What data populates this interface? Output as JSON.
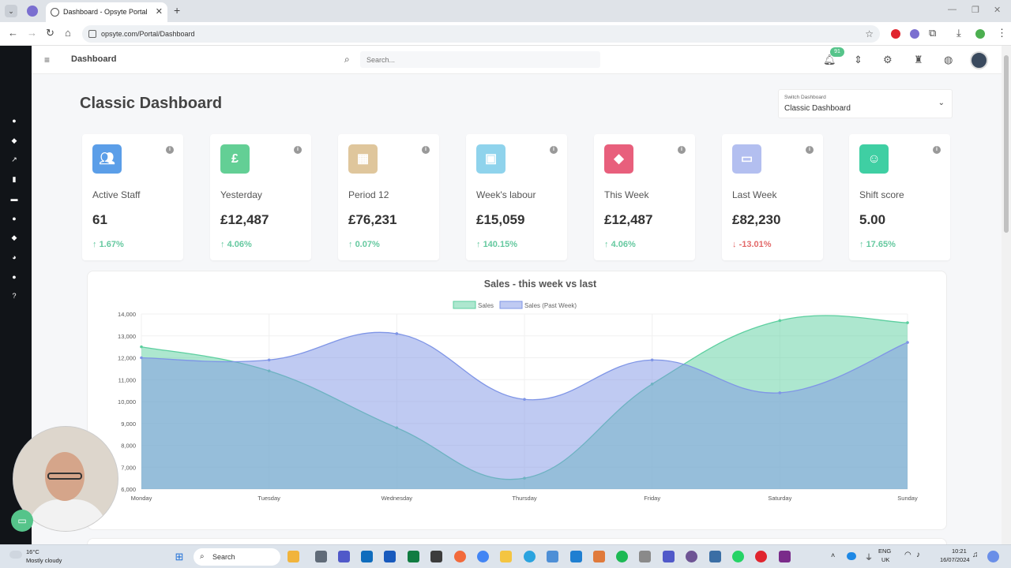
{
  "browser": {
    "tab_title": "Dashboard - Opsyte Portal",
    "url": "opsyte.com/Portal/Dashboard"
  },
  "header": {
    "breadcrumb": "Dashboard",
    "search_placeholder": "Search...",
    "notification_count": "91"
  },
  "page": {
    "title": "Classic Dashboard",
    "switch_label": "Switch Dashboard",
    "switch_value": "Classic Dashboard"
  },
  "cards": [
    {
      "label": "Active Staff",
      "value": "61",
      "change": "1.67%",
      "direction": "up",
      "icon": "users-icon",
      "color": "#5b9ee8"
    },
    {
      "label": "Yesterday",
      "value": "£12,487",
      "change": "4.06%",
      "direction": "up",
      "icon": "pound-icon",
      "color": "#63cf95"
    },
    {
      "label": "Period 12",
      "value": "£76,231",
      "change": "0.07%",
      "direction": "up",
      "icon": "calendar-icon",
      "color": "#dfc69c"
    },
    {
      "label": "Week's labour",
      "value": "£15,059",
      "change": "140.15%",
      "direction": "up",
      "icon": "briefcase-icon",
      "color": "#8fd3ec"
    },
    {
      "label": "This Week",
      "value": "£12,487",
      "change": "4.06%",
      "direction": "up",
      "icon": "tag-icon",
      "color": "#e85f7c"
    },
    {
      "label": "Last Week",
      "value": "£82,230",
      "change": "-13.01%",
      "direction": "down",
      "icon": "calendar-minus-icon",
      "color": "#b3bff0"
    },
    {
      "label": "Shift score",
      "value": "5.00",
      "change": "17.65%",
      "direction": "up",
      "icon": "smile-icon",
      "color": "#3fcfa3"
    }
  ],
  "chart_data": {
    "type": "area",
    "title": "Sales - this week vs last",
    "categories": [
      "Monday",
      "Tuesday",
      "Wednesday",
      "Thursday",
      "Friday",
      "Saturday",
      "Sunday"
    ],
    "series": [
      {
        "name": "Sales",
        "values": [
          12500,
          11400,
          8800,
          6500,
          10800,
          13700,
          13600
        ],
        "color": "#5ccf9f"
      },
      {
        "name": "Sales (Past Week)",
        "values": [
          12000,
          11900,
          13100,
          10100,
          11900,
          10400,
          12700
        ],
        "color": "#7f95e6"
      }
    ],
    "ylim": [
      6000,
      14000
    ],
    "yticks": [
      "6,000",
      "7,000",
      "8,000",
      "9,000",
      "10,000",
      "11,000",
      "12,000",
      "13,000",
      "14,000"
    ],
    "legend_position": "top-center",
    "grid": true
  },
  "taskbar": {
    "temperature": "16°C",
    "weather": "Mostly cloudy",
    "search_label": "Search",
    "lang_1": "ENG",
    "lang_2": "UK",
    "time": "10:21",
    "date": "16/07/2024"
  }
}
